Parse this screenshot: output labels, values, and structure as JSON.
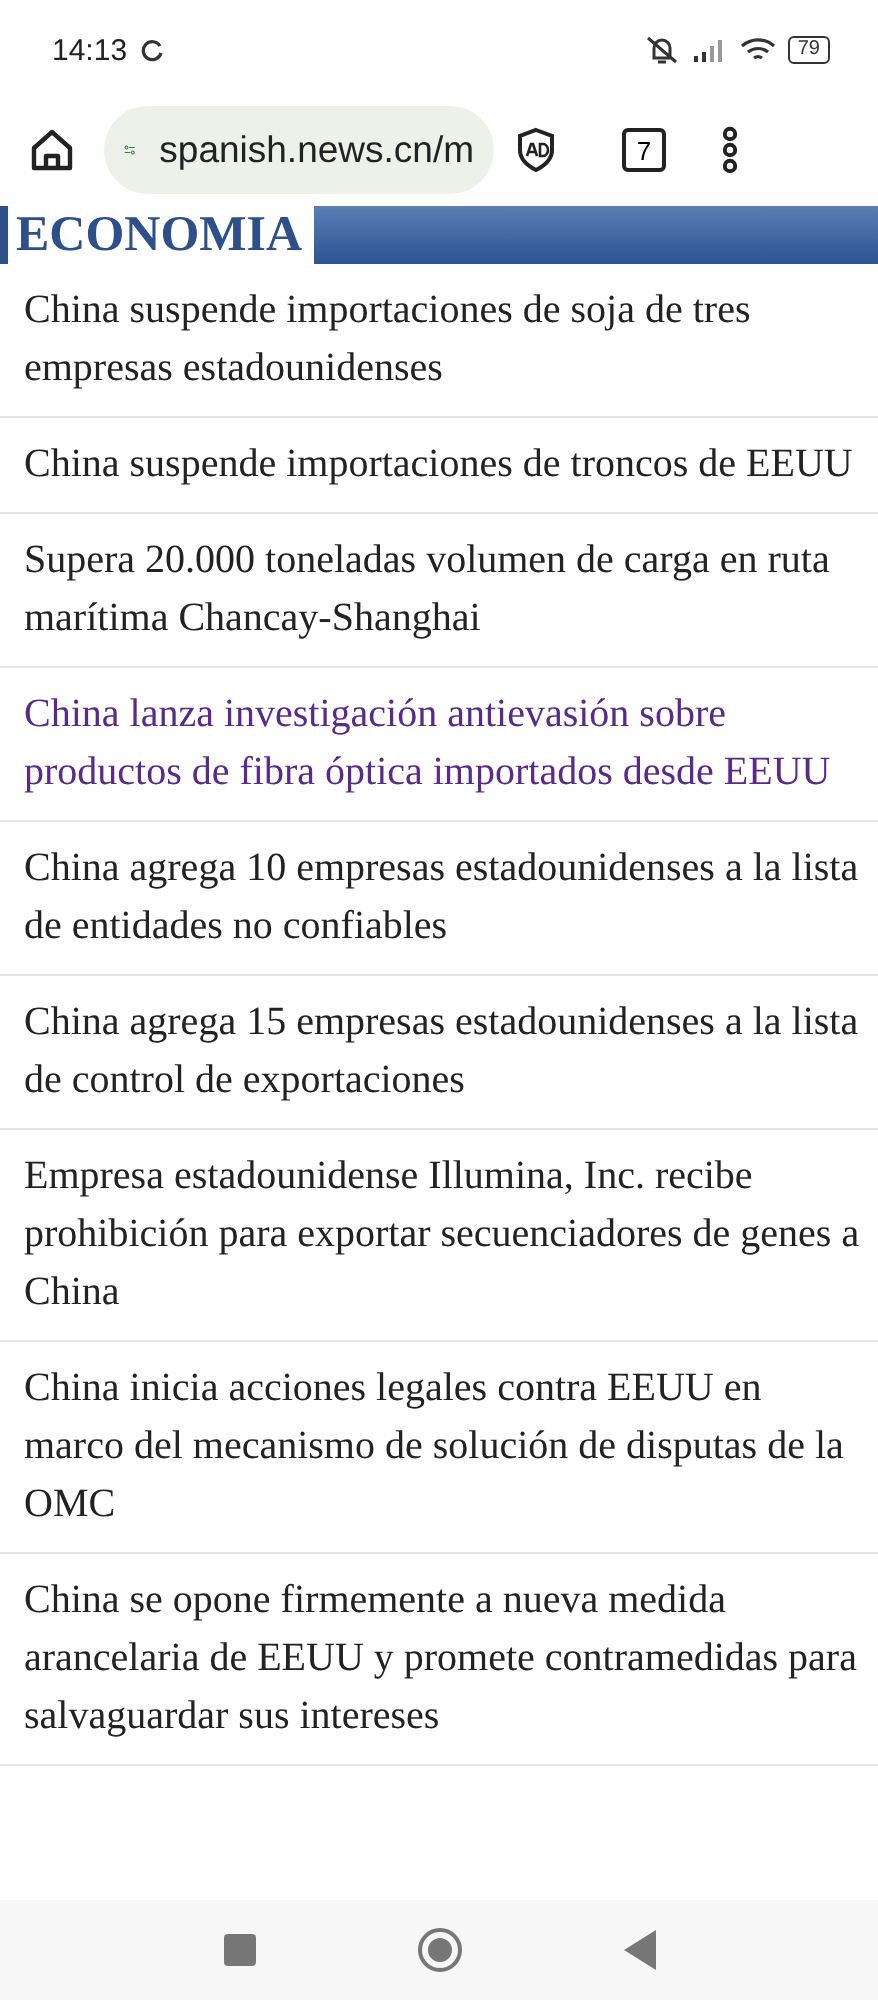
{
  "status_bar": {
    "time": "14:13",
    "battery": "79"
  },
  "browser": {
    "url": "spanish.news.cn/m",
    "tab_count": "7"
  },
  "section": {
    "title": "ECONOMIA"
  },
  "articles": [
    {
      "title": "China suspende importaciones de soja de tres empresas estadounidenses",
      "visited": false
    },
    {
      "title": "China suspende importaciones de troncos de EEUU",
      "visited": false
    },
    {
      "title": "Supera 20.000 toneladas volumen de carga en ruta marítima Chancay-Shanghai",
      "visited": false
    },
    {
      "title": "China lanza investigación antievasión sobre productos de fibra óptica importados desde EEUU",
      "visited": true
    },
    {
      "title": "China agrega 10 empresas estadounidenses a la lista de entidades no confiables",
      "visited": false
    },
    {
      "title": "China agrega 15 empresas estadounidenses a la lista de control de exportaciones",
      "visited": false
    },
    {
      "title": "Empresa estadounidense Illumina, Inc. recibe prohibición para exportar secuenciadores de genes a China",
      "visited": false
    },
    {
      "title": "China inicia acciones legales contra EEUU en marco del mecanismo de solución de disputas de la OMC",
      "visited": false
    },
    {
      "title": "China se opone firmemente a nueva medida arancelaria de EEUU y promete contramedidas para salvaguardar sus intereses",
      "visited": false
    }
  ]
}
